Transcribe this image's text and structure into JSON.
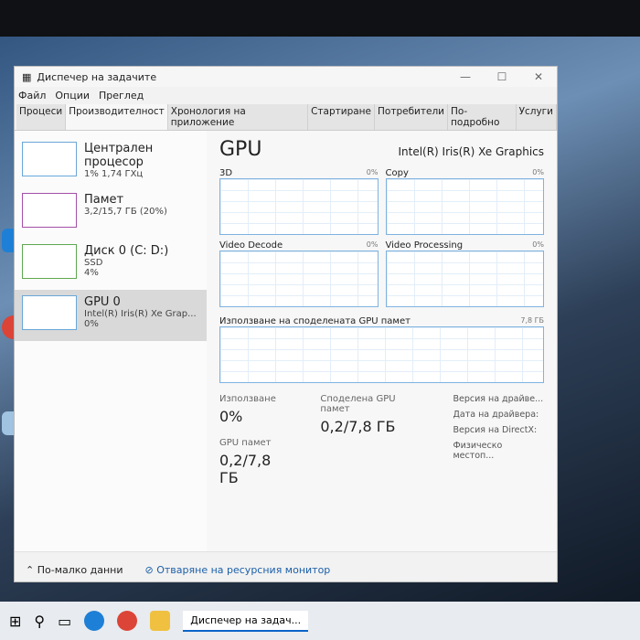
{
  "window": {
    "title": "Диспечер на задачите",
    "menu": [
      "Файл",
      "Опции",
      "Преглед"
    ],
    "tabs": [
      "Процеси",
      "Производителност",
      "Хронология на приложение",
      "Стартиране",
      "Потребители",
      "По-подробно",
      "Услуги"
    ]
  },
  "sidebar": [
    {
      "title": "Централен процесор",
      "sub": "1%  1,74 ГХц"
    },
    {
      "title": "Памет",
      "sub": "3,2/15,7 ГБ (20%)"
    },
    {
      "title": "Диск 0 (C: D:)",
      "sub": "SSD",
      "sub2": "4%"
    },
    {
      "title": "GPU 0",
      "sub": "Intel(R) Iris(R) Xe Grap...",
      "sub2": "0%"
    }
  ],
  "main": {
    "title": "GPU",
    "device": "Intel(R) Iris(R) Xe Graphics",
    "graphs": [
      {
        "label": "3D",
        "pct": "0%"
      },
      {
        "label": "Copy",
        "pct": "0%"
      },
      {
        "label": "Video Decode",
        "pct": "0%"
      },
      {
        "label": "Video Processing",
        "pct": "0%"
      }
    ],
    "shared_label": "Използване на споделената GPU памет",
    "shared_max": "7,8 ГБ",
    "usage_label": "Използване",
    "usage": "0%",
    "shared_mem_label": "Споделена GPU памет",
    "shared_mem": "0,2/7,8 ГБ",
    "gpu_mem_label": "GPU памет",
    "gpu_mem": "0,2/7,8 ГБ",
    "info": [
      "Версия на драйве...",
      "Дата на драйвера:",
      "Версия на DirectX:",
      "Физическо местоп..."
    ]
  },
  "footer": {
    "less": "По-малко данни",
    "monitor": "Отваряне на ресурсния монитор"
  },
  "taskbar": {
    "app": "Диспечер на задач..."
  }
}
